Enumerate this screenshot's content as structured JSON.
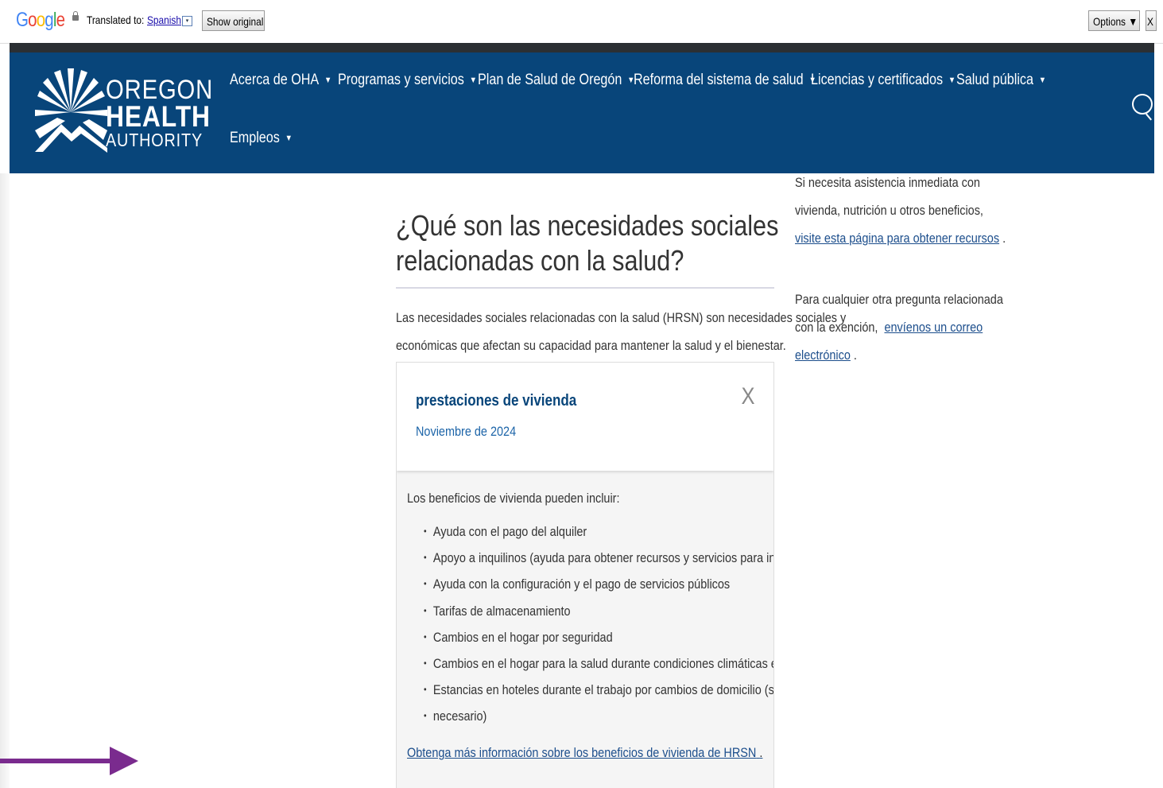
{
  "translate_bar": {
    "logo": "Google",
    "logo_letters": [
      "G",
      "o",
      "o",
      "g",
      "l",
      "e"
    ],
    "translated_to": "Translated to:",
    "language": "Spanish",
    "language_dropdown": "▾",
    "show_original": "Show original",
    "options": "Options ▼",
    "close": "X"
  },
  "header": {
    "logo": {
      "line1": "OREGON",
      "line2": "HEALTH",
      "line3": "AUTHORITY"
    },
    "nav": [
      {
        "label": "Acerca de OHA"
      },
      {
        "label": "Programas y servicios"
      },
      {
        "label": "Plan de Salud de Oregón"
      },
      {
        "label": "Reforma del sistema de salud"
      },
      {
        "label": "Licencias y certificados"
      },
      {
        "label": "Salud pública"
      },
      {
        "label": "Empleos"
      }
    ],
    "caret": "▼"
  },
  "main": {
    "title_line1": "¿Qué son las necesidades sociales",
    "title_line2": "relacionadas con la salud?",
    "intro_line1": "Las necesidades sociales relacionadas con la salud (HRSN) son necesidades sociales y",
    "intro_line2": "económicas que afectan su capacidad para mantener la salud y el bienestar.",
    "card": {
      "title": "prestaciones de vivienda",
      "date": "Noviembre de 2024",
      "close": "X",
      "lead": "Los beneficios de vivienda pueden incluir:",
      "items": [
        "Ayuda con el pago del alquiler",
        "Apoyo a inquilinos (ayuda para obtener recursos y servicios para inquilinos)",
        "Ayuda con la configuración y el pago de servicios públicos",
        "Tarifas de almacenamiento",
        "Cambios en el hogar por seguridad",
        "Cambios en el hogar para la salud durante condiciones climáticas extremas",
        "Estancias en hoteles durante el trabajo por cambios de domicilio (si es",
        "necesario)"
      ],
      "link": "Obtenga más información sobre los beneficios de vivienda de HRSN",
      "link_suffix": "."
    }
  },
  "sidebar": {
    "p1_line1": "Si necesita asistencia inmediata con",
    "p1_line2": "vivienda, nutrición u otros beneficios,",
    "p1_link": "visite esta página para obtener recursos",
    "p1_suffix": ".",
    "p2_line1": "Para cualquier otra pregunta relacionada",
    "p2_line2_prefix": "con la exención,",
    "p2_link_a": "envíenos un correo",
    "p2_link_b": "electrónico",
    "p2_suffix": "."
  },
  "colors": {
    "header_blue": "#08457a",
    "link_blue": "#1c4e8c",
    "arrow_purple": "#7a2b8e"
  }
}
